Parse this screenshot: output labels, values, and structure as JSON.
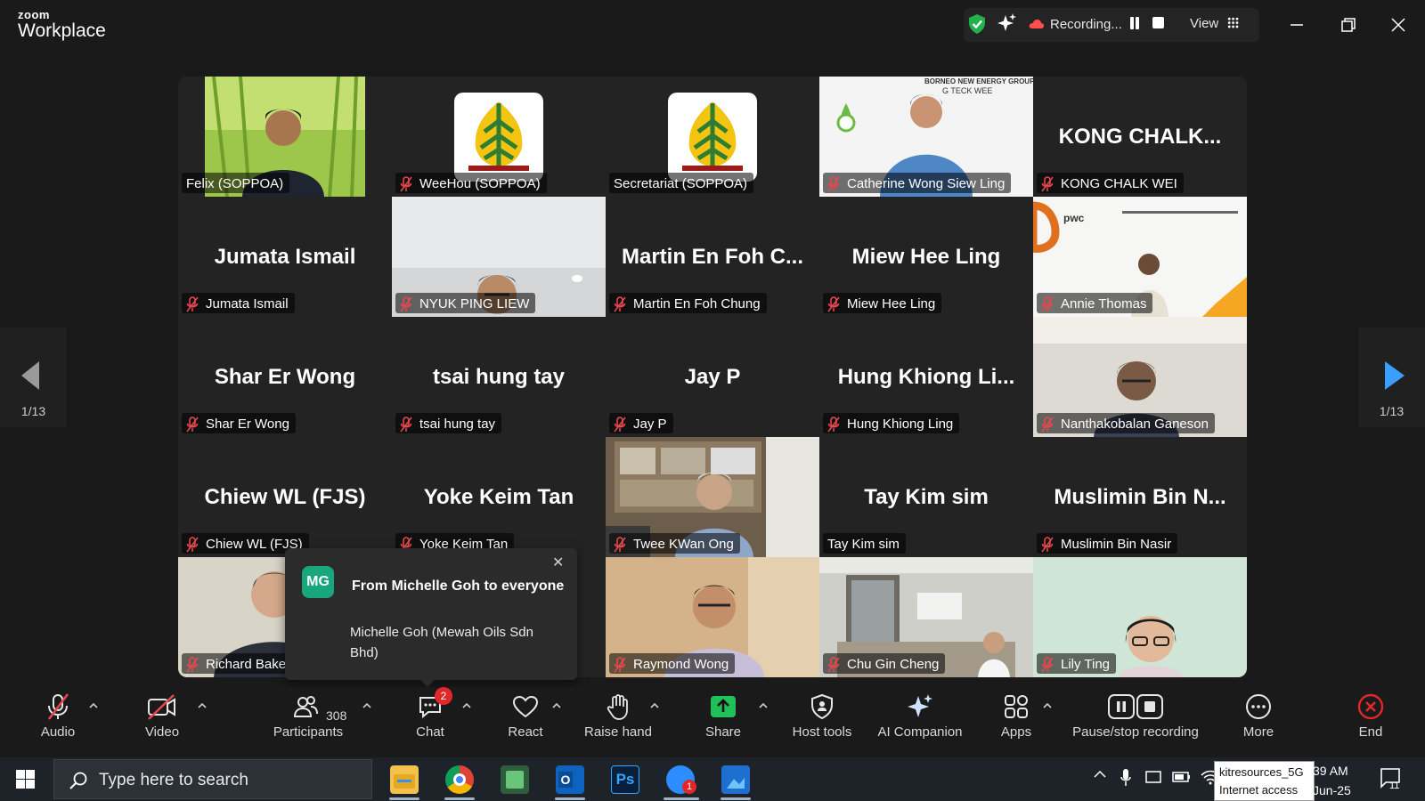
{
  "app": {
    "brand_small": "zoom",
    "brand_large": "Workplace"
  },
  "titlebar": {
    "recording_label": "Recording...",
    "view_label": "View"
  },
  "pager": {
    "left_count": "1/13",
    "right_count": "1/13"
  },
  "tiles": [
    {
      "label": "Felix (SOPPOA)",
      "big": "",
      "kind": "video-green",
      "muted": false
    },
    {
      "label": "WeeHou (SOPPOA)",
      "big": "",
      "kind": "logo",
      "muted": true
    },
    {
      "label": "Secretariat (SOPPOA)",
      "big": "",
      "kind": "logo",
      "muted": false,
      "active": true
    },
    {
      "label": "Catherine Wong Siew Ling",
      "big": "",
      "kind": "video-white",
      "muted": true,
      "banner": "BORNEO NEW ENERGY GROUP",
      "banner2": "G TECK WEE"
    },
    {
      "label": "KONG CHALK WEI",
      "big": "KONG  CHALK...",
      "kind": "name",
      "muted": true
    },
    {
      "label": "Jumata Ismail",
      "big": "Jumata Ismail",
      "kind": "name",
      "muted": true
    },
    {
      "label": "NYUK PING LIEW",
      "big": "",
      "kind": "video-wall",
      "muted": true
    },
    {
      "label": "Martin En Foh Chung",
      "big": "Martin En Foh C...",
      "kind": "name",
      "muted": true
    },
    {
      "label": "Miew Hee Ling",
      "big": "Miew Hee Ling",
      "kind": "name",
      "muted": true
    },
    {
      "label": "Annie Thomas",
      "big": "",
      "kind": "video-pwc",
      "muted": true,
      "brand": "pwc"
    },
    {
      "label": "Shar Er Wong",
      "big": "Shar Er Wong",
      "kind": "name",
      "muted": true
    },
    {
      "label": "tsai hung tay",
      "big": "tsai hung tay",
      "kind": "name",
      "muted": true
    },
    {
      "label": "Jay P",
      "big": "Jay P",
      "kind": "name",
      "muted": true
    },
    {
      "label": "Hung Khiong Ling",
      "big": "Hung Khiong Li...",
      "kind": "name",
      "muted": true
    },
    {
      "label": "Nanthakobalan Ganeson",
      "big": "",
      "kind": "video-room",
      "muted": true
    },
    {
      "label": "Chiew WL (FJS)",
      "big": "Chiew WL (FJS)",
      "kind": "name",
      "muted": true
    },
    {
      "label": "Yoke Keim Tan",
      "big": "Yoke Keim Tan",
      "kind": "name",
      "muted": true
    },
    {
      "label": "Twee KWan Ong",
      "big": "",
      "kind": "video-office",
      "muted": true
    },
    {
      "label": "Tay Kim sim",
      "big": "Tay Kim sim",
      "kind": "name",
      "muted": false
    },
    {
      "label": "Muslimin Bin Nasir",
      "big": "Muslimin Bin N...",
      "kind": "name",
      "muted": true
    },
    {
      "label": "Richard Bake",
      "big": "",
      "kind": "video-beige",
      "muted": true
    },
    {
      "label": "",
      "big": "",
      "kind": "empty",
      "muted": false
    },
    {
      "label": "Raymond Wong",
      "big": "",
      "kind": "video-warm",
      "muted": true
    },
    {
      "label": "Chu Gin Cheng",
      "big": "",
      "kind": "video-meeting",
      "muted": true
    },
    {
      "label": "Lily Ting",
      "big": "",
      "kind": "video-mint",
      "muted": true
    }
  ],
  "chat_popup": {
    "avatar": "MG",
    "from": "From Michelle Goh to everyone",
    "message": "Michelle Goh (Mewah Oils Sdn Bhd)"
  },
  "toolbar": {
    "audio": "Audio",
    "video": "Video",
    "participants": "Participants",
    "participants_count": "308",
    "chat": "Chat",
    "chat_badge": "2",
    "react": "React",
    "raise_hand": "Raise hand",
    "share": "Share",
    "host_tools": "Host tools",
    "ai_companion": "AI Companion",
    "apps": "Apps",
    "pause_stop": "Pause/stop recording",
    "more": "More",
    "end": "End"
  },
  "taskbar": {
    "search_placeholder": "Type here to search",
    "wifi_name": "kitresources_5G",
    "wifi_status": "Internet access",
    "time": "39 AM",
    "date": "Jun-25",
    "notif_count": "11",
    "zoom_badge": "1"
  },
  "colors": {
    "active_border": "#2bd67b",
    "muted_red": "#e5484d",
    "share_green": "#20c05a",
    "end_red": "#e02828",
    "chat_avatar": "#18a77d"
  }
}
